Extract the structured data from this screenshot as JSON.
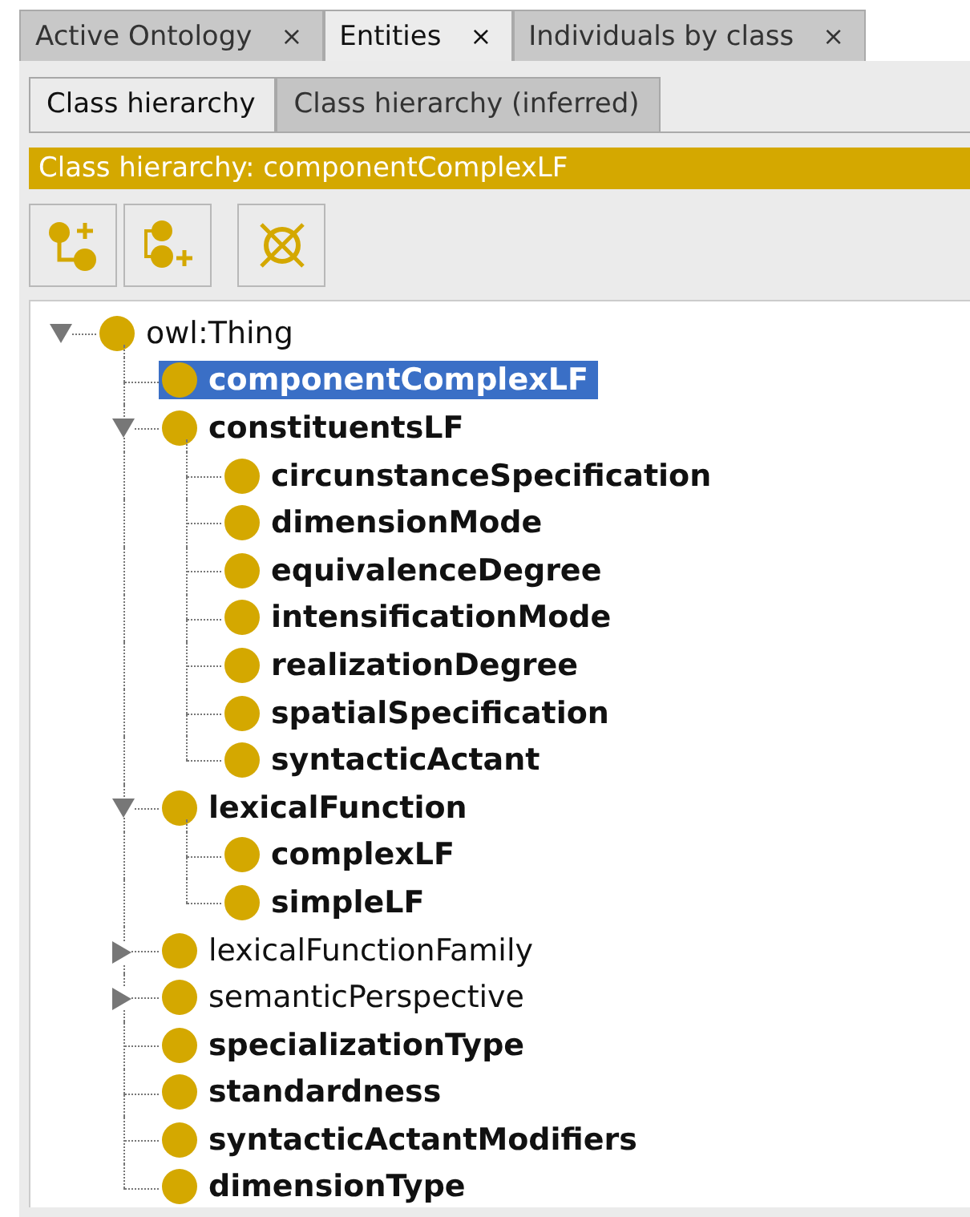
{
  "tabs": [
    {
      "label": "Active Ontology",
      "close": "×",
      "selected": false
    },
    {
      "label": "Entities",
      "close": "×",
      "selected": true
    },
    {
      "label": "Individuals by class",
      "close": "×",
      "selected": false
    }
  ],
  "subtabs": [
    {
      "label": "Class hierarchy",
      "selected": true
    },
    {
      "label": "Class hierarchy (inferred)",
      "selected": false
    }
  ],
  "panel_title": "Class hierarchy: componentComplexLF",
  "toolbar": [
    {
      "kind": "add-child"
    },
    {
      "kind": "add-sibling"
    },
    {
      "kind": "delete"
    }
  ],
  "tree": [
    {
      "label": "owl:Thing",
      "bold": false,
      "selected": false,
      "expanded": true,
      "children": [
        {
          "label": "componentComplexLF",
          "bold": true,
          "selected": true
        },
        {
          "label": "constituentsLF",
          "bold": true,
          "selected": false,
          "expanded": true,
          "children": [
            {
              "label": "circunstanceSpecification",
              "bold": true,
              "selected": false
            },
            {
              "label": "dimensionMode",
              "bold": true,
              "selected": false
            },
            {
              "label": "equivalenceDegree",
              "bold": true,
              "selected": false
            },
            {
              "label": "intensificationMode",
              "bold": true,
              "selected": false
            },
            {
              "label": "realizationDegree",
              "bold": true,
              "selected": false
            },
            {
              "label": "spatialSpecification",
              "bold": true,
              "selected": false
            },
            {
              "label": "syntacticActant",
              "bold": true,
              "selected": false
            }
          ]
        },
        {
          "label": "lexicalFunction",
          "bold": true,
          "selected": false,
          "expanded": true,
          "children": [
            {
              "label": "complexLF",
              "bold": true,
              "selected": false
            },
            {
              "label": "simpleLF",
              "bold": true,
              "selected": false
            }
          ]
        },
        {
          "label": "lexicalFunctionFamily",
          "bold": false,
          "selected": false,
          "expanded": false
        },
        {
          "label": "semanticPerspective",
          "bold": false,
          "selected": false,
          "expanded": false
        },
        {
          "label": "specializationType",
          "bold": true,
          "selected": false
        },
        {
          "label": "standardness",
          "bold": true,
          "selected": false
        },
        {
          "label": "syntacticActantModifiers",
          "bold": true,
          "selected": false
        },
        {
          "label": "dimensionType",
          "bold": true,
          "selected": false
        }
      ]
    }
  ]
}
